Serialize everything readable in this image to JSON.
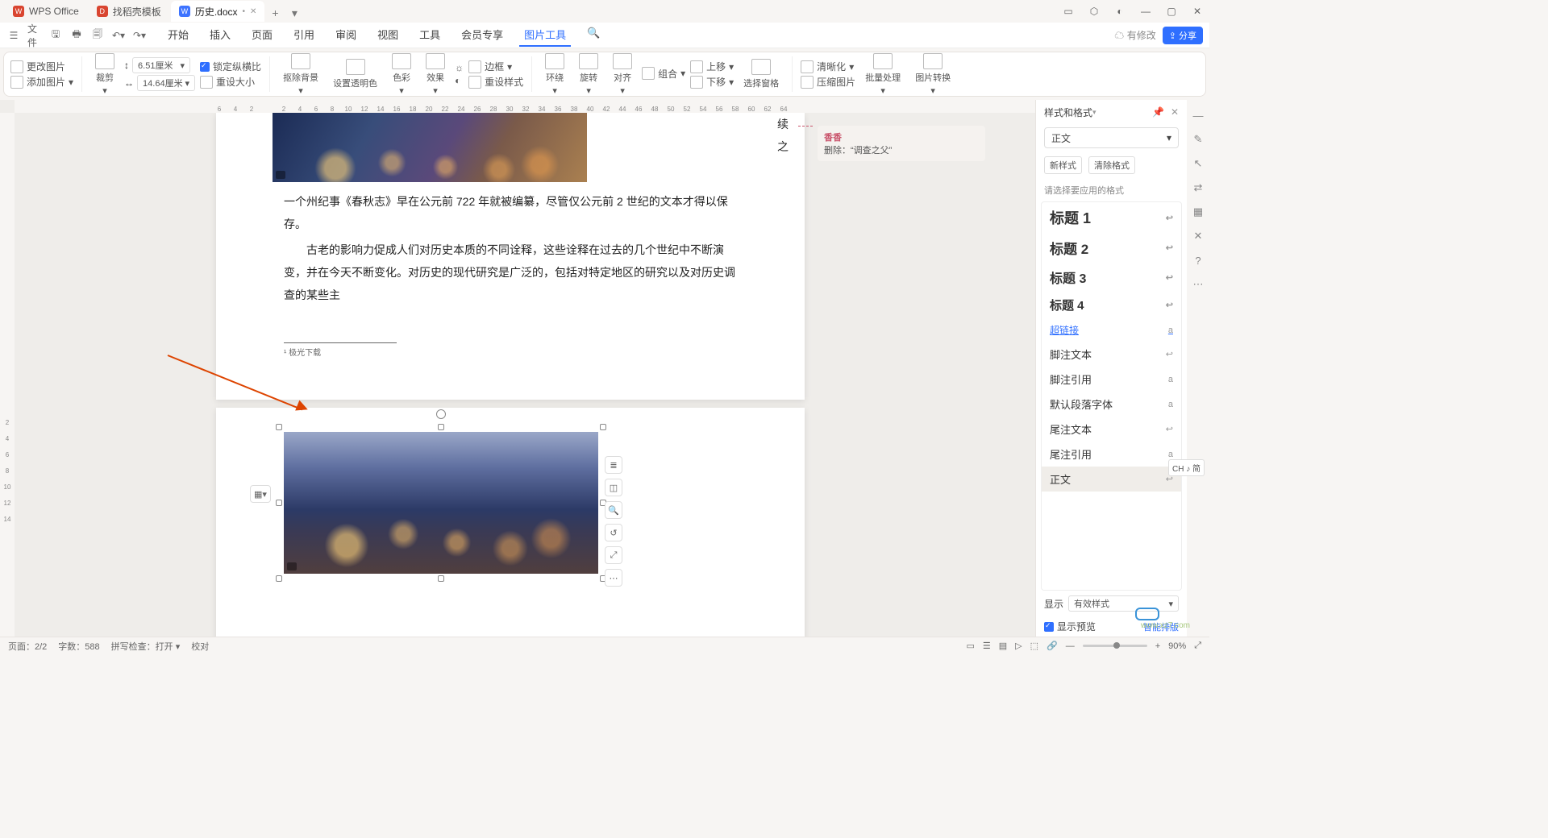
{
  "tabs": [
    {
      "label": "WPS Office",
      "icon": "W",
      "iconClass": "ico-w"
    },
    {
      "label": "找稻壳模板",
      "icon": "D",
      "iconClass": "ico-d"
    },
    {
      "label": "历史.docx",
      "icon": "W",
      "iconClass": "ico-doc",
      "active": true,
      "dirty": "•"
    }
  ],
  "newtab": "+",
  "menu": {
    "file": "文件",
    "items": [
      "开始",
      "插入",
      "页面",
      "引用",
      "审阅",
      "视图",
      "工具",
      "会员专享",
      "图片工具"
    ],
    "activeIndex": 8,
    "cloud": "有修改",
    "share": "分享"
  },
  "ribbon": {
    "changePic": "更改图片",
    "addPic": "添加图片",
    "crop": "裁剪",
    "width": "6.51厘米",
    "height": "14.64厘米",
    "lock": "锁定纵横比",
    "reset": "重设大小",
    "removeBg": "抠除背景",
    "setTrans": "设置透明色",
    "color": "色彩",
    "effect": "效果",
    "border": "边框",
    "resetStyle": "重设样式",
    "wrap": "环绕",
    "rotate": "旋转",
    "align": "对齐",
    "group": "组合",
    "up": "上移",
    "down": "下移",
    "selPane": "选择窗格",
    "clear": "清晰化",
    "zipPic": "压缩图片",
    "batch": "批量处理",
    "convert": "图片转换"
  },
  "doc": {
    "line1": "续",
    "line2": "之",
    "para1": "一个州纪事《春秋志》早在公元前 722 年就被编纂，尽管仅公元前 2 世纪的文本才得以保存。",
    "para2": "古老的影响力促成人们对历史本质的不同诠释，这些诠释在过去的几个世纪中不断演变，并在今天不断变化。对历史的现代研究是广泛的，包括对特定地区的研究以及对历史调查的某些主",
    "footnote": "¹ 极光下载"
  },
  "comment": {
    "author": "香香",
    "action": "删除：",
    "content": "“调查之父”"
  },
  "panel": {
    "title": "样式和格式",
    "current": "正文",
    "newStyle": "新样式",
    "clearFmt": "清除格式",
    "hint": "请选择要应用的格式",
    "styles": [
      {
        "name": "标题 1",
        "cls": "h1",
        "mk": "↩"
      },
      {
        "name": "标题 2",
        "cls": "h2",
        "mk": "↩"
      },
      {
        "name": "标题 3",
        "cls": "h3",
        "mk": "↩"
      },
      {
        "name": "标题 4",
        "cls": "h4",
        "mk": "↩"
      },
      {
        "name": "超链接",
        "cls": "link",
        "mk": "a"
      },
      {
        "name": "脚注文本",
        "cls": "",
        "mk": "↩"
      },
      {
        "name": "脚注引用",
        "cls": "",
        "mk": "a"
      },
      {
        "name": "默认段落字体",
        "cls": "",
        "mk": "a"
      },
      {
        "name": "尾注文本",
        "cls": "",
        "mk": "↩"
      },
      {
        "name": "尾注引用",
        "cls": "",
        "mk": "a"
      },
      {
        "name": "正文",
        "cls": "sel",
        "mk": "↩"
      }
    ],
    "showLabel": "显示",
    "showVal": "有效样式",
    "preview": "显示预览",
    "smart": "智能排版"
  },
  "status": {
    "page": "页面：2/2",
    "words": "字数：588",
    "spell": "拼写检查：打开",
    "proof": "校对",
    "zoom": "90%"
  },
  "ime": "CH ♪ 简",
  "watermark": "www.xz7.com",
  "rulerH": [
    "6",
    "4",
    "2",
    "",
    "2",
    "4",
    "6",
    "8",
    "10",
    "12",
    "14",
    "16",
    "18",
    "20",
    "22",
    "24",
    "26",
    "28",
    "30",
    "32",
    "34",
    "36",
    "38",
    "40",
    "42",
    "44",
    "46",
    "48",
    "50",
    "52",
    "54",
    "56",
    "58",
    "60",
    "62",
    "64"
  ],
  "rulerV": [
    "",
    "2",
    "4",
    "6",
    "8",
    "10",
    "12",
    "14"
  ]
}
